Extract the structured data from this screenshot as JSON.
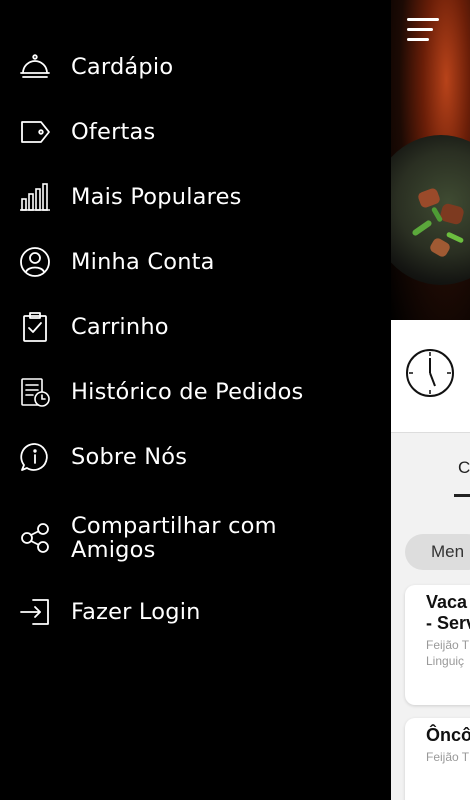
{
  "drawer": {
    "items": [
      {
        "label": "Cardápio",
        "icon": "cloche-icon"
      },
      {
        "label": "Ofertas",
        "icon": "tag-icon"
      },
      {
        "label": "Mais Populares",
        "icon": "bar-chart-icon"
      },
      {
        "label": "Minha Conta",
        "icon": "user-circle-icon"
      },
      {
        "label": "Carrinho",
        "icon": "clipboard-check-icon"
      },
      {
        "label": "Histórico de Pedidos",
        "icon": "order-history-icon"
      },
      {
        "label": "Sobre Nós",
        "icon": "info-chat-icon"
      },
      {
        "label": "Compartilhar com\nAmigos",
        "icon": "share-icon"
      },
      {
        "label": "Fazer Login",
        "icon": "login-icon"
      }
    ]
  },
  "background": {
    "menu_icon": "hamburger-menu-icon",
    "clock_icon": "clock-icon",
    "tab_label": "C",
    "category_chip": "Men",
    "cards": [
      {
        "title": "Vaca\n- Serv",
        "subtitle": "Feijão T\nLinguiç"
      },
      {
        "title": "Ôncô",
        "subtitle": "Feijão T"
      }
    ]
  },
  "colors": {
    "drawer_bg": "#000000",
    "drawer_text": "#ffffff",
    "content_bg": "#f2f2f2"
  }
}
